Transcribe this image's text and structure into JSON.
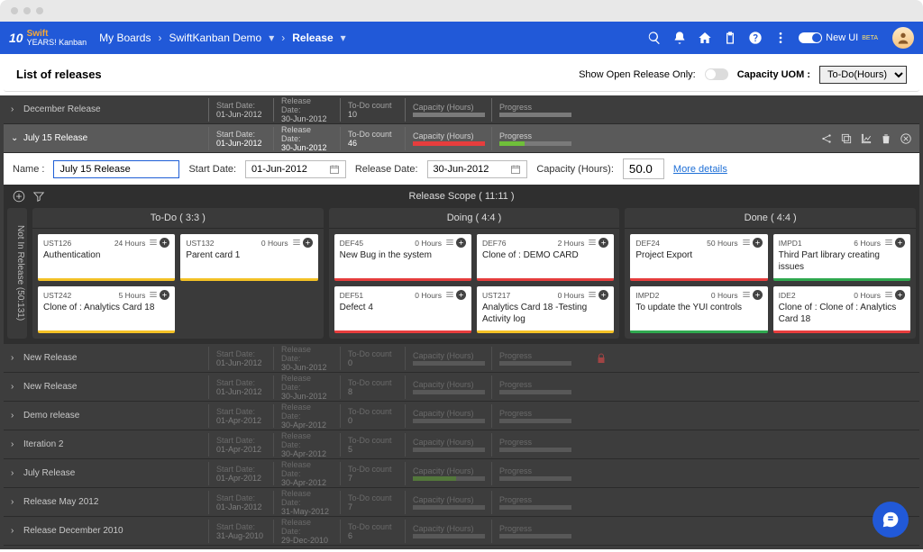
{
  "nav": {
    "my_boards": "My Boards",
    "project": "SwiftKanban Demo",
    "section": "Release",
    "new_ui": "New UI",
    "beta": "BETA"
  },
  "header": {
    "title": "List of releases",
    "show_open_label": "Show Open Release Only:",
    "uom_label": "Capacity UOM :",
    "uom_value": "To-Do(Hours)"
  },
  "detail": {
    "name_label": "Name :",
    "name_value": "July 15 Release",
    "start_label": "Start Date:",
    "start_value": "01-Jun-2012",
    "release_label": "Release Date:",
    "release_value": "30-Jun-2012",
    "cap_label": "Capacity (Hours):",
    "cap_value": "50.0",
    "more": "More details"
  },
  "board": {
    "scope_label": "Release Scope ( 11:11 )",
    "not_in_label": "Not In Release (50:131)",
    "cols": [
      {
        "label": "To-Do ( 3:3 )"
      },
      {
        "label": "Doing ( 4:4 )"
      },
      {
        "label": "Done ( 4:4 )"
      }
    ]
  },
  "cards": {
    "todo": [
      {
        "id": "UST126",
        "hours": "24 Hours",
        "title": "Authentication",
        "color": "orange"
      },
      {
        "id": "UST132",
        "hours": "0 Hours",
        "title": "Parent card 1",
        "color": "orange"
      },
      {
        "id": "UST242",
        "hours": "5 Hours",
        "title": "Clone of : Analytics Card 18",
        "color": "orange"
      }
    ],
    "doing": [
      {
        "id": "DEF45",
        "hours": "0 Hours",
        "title": "New Bug in the system",
        "color": "red"
      },
      {
        "id": "DEF76",
        "hours": "2 Hours",
        "title": "Clone of : DEMO CARD",
        "color": "red"
      },
      {
        "id": "DEF51",
        "hours": "0 Hours",
        "title": "Defect 4",
        "color": "red"
      },
      {
        "id": "UST217",
        "hours": "0 Hours",
        "title": "Analytics Card 18 -Testing Activity log",
        "color": "orange"
      }
    ],
    "done": [
      {
        "id": "DEF24",
        "hours": "50 Hours",
        "title": "Project Export",
        "color": "red"
      },
      {
        "id": "IMPD1",
        "hours": "6 Hours",
        "title": "Third Part library creating issues",
        "color": "green"
      },
      {
        "id": "IMPD2",
        "hours": "0 Hours",
        "title": "To update the YUI controls",
        "color": "green"
      },
      {
        "id": "IDE2",
        "hours": "0 Hours",
        "title": "Clone of : Clone of : Analytics Card 18",
        "color": "red"
      }
    ]
  },
  "releases": [
    {
      "name": "December Release",
      "start": "01-Jun-2012",
      "rel": "30-Jun-2012",
      "todo": "10",
      "cap": "plain",
      "prog": "plain",
      "dim": false,
      "sel": false
    },
    {
      "name": "July 15 Release",
      "start": "01-Jun-2012",
      "rel": "30-Jun-2012",
      "todo": "46",
      "cap": "red",
      "prog": "green",
      "dim": false,
      "sel": true
    },
    {
      "name": "New Release",
      "start": "01-Jun-2012",
      "rel": "30-Jun-2012",
      "todo": "0",
      "cap": "plain",
      "prog": "plain",
      "dim": true,
      "sel": false,
      "lock": true
    },
    {
      "name": "New Release",
      "start": "01-Jun-2012",
      "rel": "30-Jun-2012",
      "todo": "8",
      "cap": "plain",
      "prog": "plain",
      "dim": true,
      "sel": false
    },
    {
      "name": "Demo release",
      "start": "01-Apr-2012",
      "rel": "30-Apr-2012",
      "todo": "0",
      "cap": "plain",
      "prog": "plain",
      "dim": true,
      "sel": false
    },
    {
      "name": "Iteration 2",
      "start": "01-Apr-2012",
      "rel": "30-Apr-2012",
      "todo": "5",
      "cap": "plain",
      "prog": "plain",
      "dim": true,
      "sel": false
    },
    {
      "name": "July Release",
      "start": "01-Apr-2012",
      "rel": "30-Apr-2012",
      "todo": "7",
      "cap": "green",
      "prog": "plain",
      "dim": true,
      "sel": false
    },
    {
      "name": "Release May 2012",
      "start": "01-Jan-2012",
      "rel": "31-May-2012",
      "todo": "7",
      "cap": "plain",
      "prog": "plain",
      "dim": true,
      "sel": false
    },
    {
      "name": "Release December 2010",
      "start": "31-Aug-2010",
      "rel": "29-Dec-2010",
      "todo": "6",
      "cap": "plain",
      "prog": "plain",
      "dim": true,
      "sel": false
    }
  ],
  "labels": {
    "start": "Start Date:",
    "rel": "Release Date:",
    "todo": "To-Do count",
    "cap": "Capacity (Hours)",
    "prog": "Progress"
  }
}
